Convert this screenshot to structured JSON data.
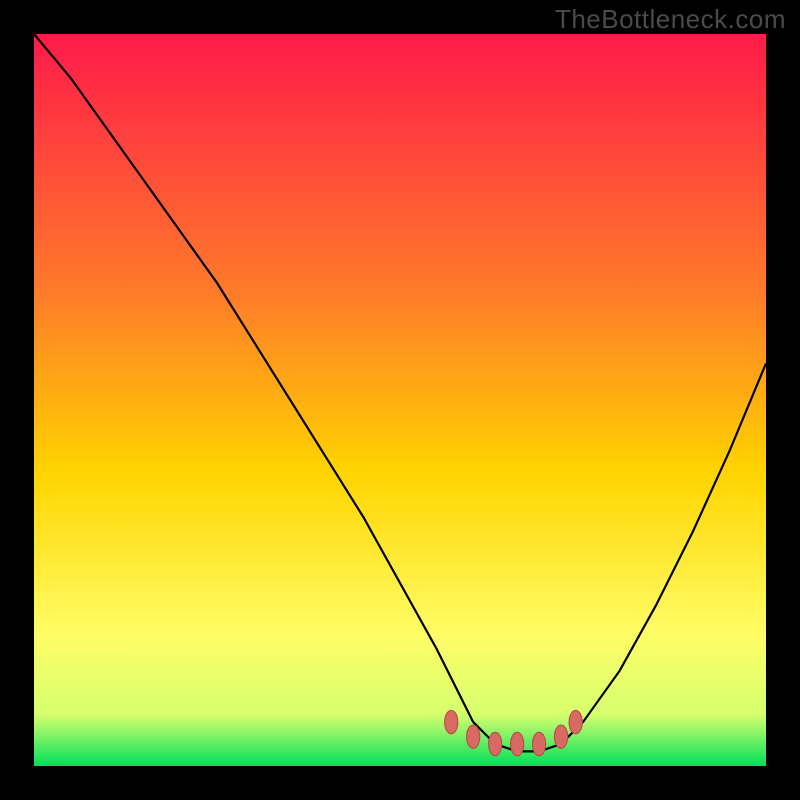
{
  "watermark": "TheBottleneck.com",
  "colors": {
    "bg_black": "#000000",
    "grad_top": "#ff1a4a",
    "grad_mid1": "#ff7a2a",
    "grad_mid2": "#ffd400",
    "grad_mid3": "#fffd66",
    "grad_bottom1": "#d6ff6e",
    "grad_bottom2": "#00e05a",
    "curve": "#000000",
    "marker_fill": "#d86a63",
    "marker_stroke": "#b84b45"
  },
  "chart_data": {
    "type": "line",
    "title": "",
    "xlabel": "",
    "ylabel": "",
    "xlim": [
      0,
      100
    ],
    "ylim": [
      0,
      100
    ],
    "series": [
      {
        "name": "bottleneck-curve",
        "x": [
          0,
          5,
          10,
          15,
          20,
          25,
          30,
          35,
          40,
          45,
          50,
          55,
          58,
          60,
          63,
          66,
          69,
          72,
          75,
          80,
          85,
          90,
          95,
          100
        ],
        "values": [
          100,
          94,
          87,
          80,
          73,
          66,
          58,
          50,
          42,
          34,
          25,
          16,
          10,
          6,
          3,
          2,
          2,
          3,
          6,
          13,
          22,
          32,
          43,
          55
        ]
      }
    ],
    "markers": {
      "name": "highlighted-range",
      "x": [
        57,
        60,
        63,
        66,
        69,
        72,
        74
      ],
      "values": [
        6,
        4,
        3,
        3,
        3,
        4,
        6
      ]
    }
  }
}
